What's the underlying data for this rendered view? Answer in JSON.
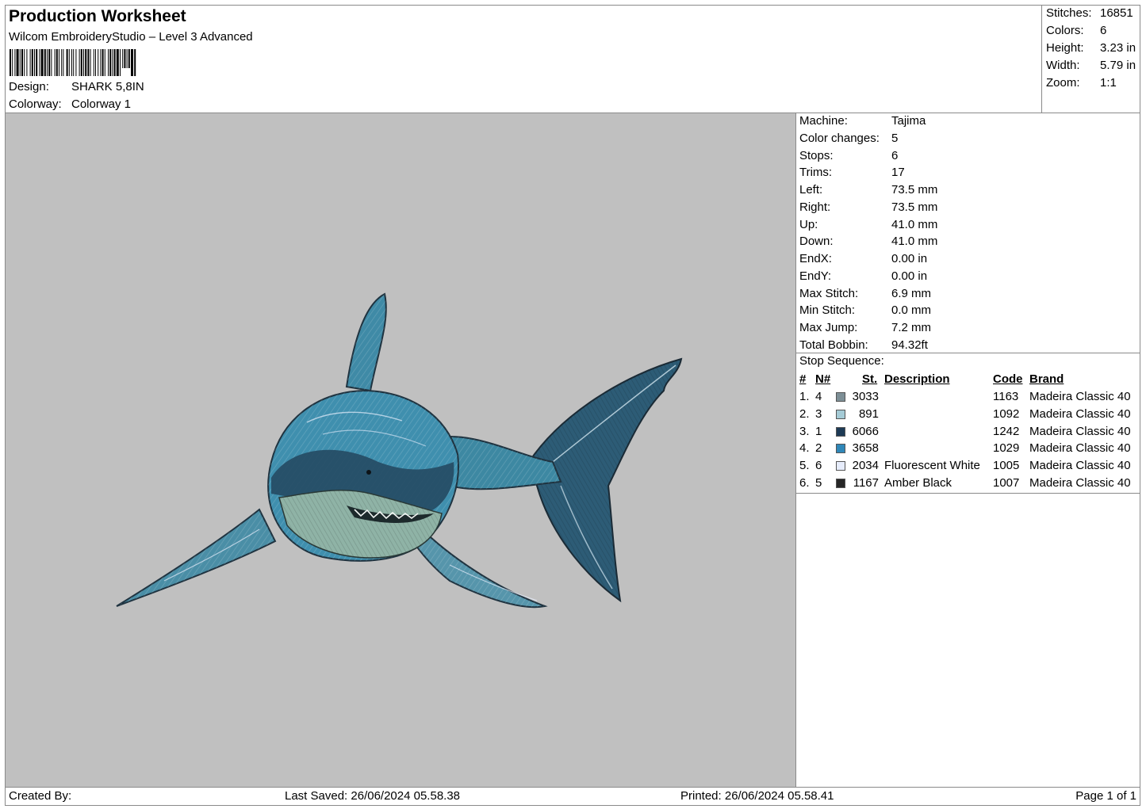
{
  "header": {
    "title": "Production Worksheet",
    "software": "Wilcom EmbroideryStudio – Level 3 Advanced",
    "design_label": "Design:",
    "design_value": "SHARK 5,8IN",
    "colorway_label": "Colorway:",
    "colorway_value": "Colorway 1"
  },
  "summary": [
    {
      "label": "Stitches:",
      "value": "16851"
    },
    {
      "label": "Colors:",
      "value": "6"
    },
    {
      "label": "Height:",
      "value": "3.23 in"
    },
    {
      "label": "Width:",
      "value": "5.79 in"
    },
    {
      "label": "Zoom:",
      "value": "1:1"
    }
  ],
  "machine_info": [
    {
      "label": "Machine:",
      "value": "Tajima"
    },
    {
      "label": "Color changes:",
      "value": "5"
    },
    {
      "label": "Stops:",
      "value": "6"
    },
    {
      "label": "Trims:",
      "value": "17"
    },
    {
      "label": "Left:",
      "value": "73.5 mm"
    },
    {
      "label": "Right:",
      "value": "73.5 mm"
    },
    {
      "label": "Up:",
      "value": "41.0 mm"
    },
    {
      "label": "Down:",
      "value": "41.0 mm"
    },
    {
      "label": "EndX:",
      "value": "0.00 in"
    },
    {
      "label": "EndY:",
      "value": "0.00 in"
    },
    {
      "label": "Max Stitch:",
      "value": "6.9 mm"
    },
    {
      "label": "Min Stitch:",
      "value": "0.0 mm"
    },
    {
      "label": "Max Jump:",
      "value": "7.2 mm"
    },
    {
      "label": "Total Bobbin:",
      "value": "94.32ft"
    }
  ],
  "stop_sequence": {
    "title": "Stop Sequence:",
    "headers": {
      "num": "#",
      "n": "N#",
      "st": "St.",
      "description": "Description",
      "code": "Code",
      "brand": "Brand"
    },
    "rows": [
      {
        "num": "1.",
        "n": "4",
        "color": "#7d8f96",
        "st": "3033",
        "description": "",
        "code": "1163",
        "brand": "Madeira Classic 40"
      },
      {
        "num": "2.",
        "n": "3",
        "color": "#a5cbd6",
        "st": "891",
        "description": "",
        "code": "1092",
        "brand": "Madeira Classic 40"
      },
      {
        "num": "3.",
        "n": "1",
        "color": "#1d3a55",
        "st": "6066",
        "description": "",
        "code": "1242",
        "brand": "Madeira Classic 40"
      },
      {
        "num": "4.",
        "n": "2",
        "color": "#2f87b8",
        "st": "3658",
        "description": "",
        "code": "1029",
        "brand": "Madeira Classic 40"
      },
      {
        "num": "5.",
        "n": "6",
        "color": "#e6ecfb",
        "st": "2034",
        "description": "Fluorescent White",
        "code": "1005",
        "brand": "Madeira Classic 40"
      },
      {
        "num": "6.",
        "n": "5",
        "color": "#262626",
        "st": "1167",
        "description": "Amber Black",
        "code": "1007",
        "brand": "Madeira Classic 40"
      }
    ]
  },
  "footer": {
    "created_by": "Created By:",
    "last_saved": "Last Saved: 26/06/2024 05.58.38",
    "printed": "Printed: 26/06/2024 05.58.41",
    "page": "Page 1 of 1"
  },
  "preview": {
    "background": "#c0c0c0"
  }
}
